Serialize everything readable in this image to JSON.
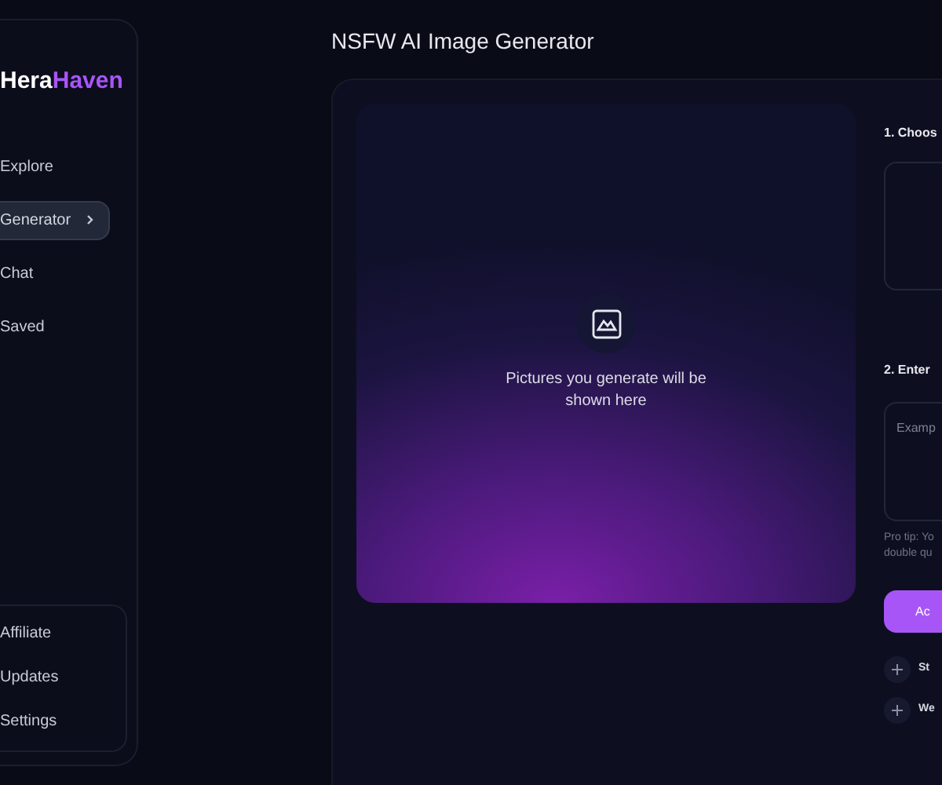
{
  "sidebar": {
    "logo": {
      "first": "Hera",
      "second": "Haven"
    },
    "nav": [
      {
        "label": "Explore",
        "selected": false
      },
      {
        "label": "Generator",
        "selected": true
      },
      {
        "label": "Chat",
        "selected": false
      },
      {
        "label": "Saved",
        "selected": false
      }
    ],
    "footer": [
      "Affiliate",
      "Updates",
      "Settings"
    ]
  },
  "page": {
    "title": "NSFW AI Image Generator"
  },
  "preview": {
    "message": "Pictures you generate will be shown here"
  },
  "form": {
    "step_1": "1. Choos",
    "step_2": "2. Enter",
    "prompt_placeholder": "Examp",
    "tip": [
      "Pro tip: Yo",
      "double qu"
    ],
    "submit": "Ac",
    "options": [
      "St",
      "We"
    ]
  }
}
